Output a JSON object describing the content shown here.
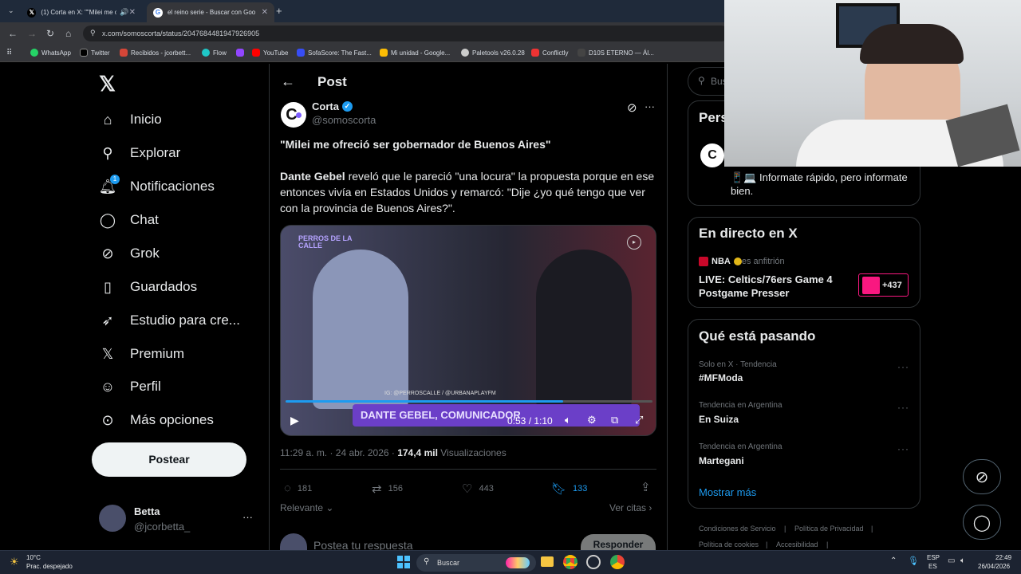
{
  "browser": {
    "tabs": [
      {
        "title": "(1) Corta en X: \"\"Milei me o"
      },
      {
        "title": "el reino serie - Buscar con Goo"
      }
    ],
    "url": "x.com/somoscorta/status/2047684481947926905",
    "bookmarks": [
      "WhatsApp",
      "Twitter",
      "Recibidos - jcorbett...",
      "Flow",
      "",
      "YouTube",
      "SofaScore: The Fast...",
      "Mi unidad - Google...",
      "Paletools v26.0.28",
      "Conflictly",
      "D10S ETERNO — Ál..."
    ]
  },
  "sidebar": {
    "items": [
      {
        "label": "Inicio",
        "icon": "home-icon"
      },
      {
        "label": "Explorar",
        "icon": "search-icon"
      },
      {
        "label": "Notificaciones",
        "icon": "bell-icon",
        "badge": "1"
      },
      {
        "label": "Chat",
        "icon": "chat-icon"
      },
      {
        "label": "Grok",
        "icon": "grok-icon"
      },
      {
        "label": "Guardados",
        "icon": "bookmark-icon"
      },
      {
        "label": "Estudio para cre...",
        "icon": "rocket-icon"
      },
      {
        "label": "Premium",
        "icon": "x-logo-icon"
      },
      {
        "label": "Perfil",
        "icon": "person-icon"
      },
      {
        "label": "Más opciones",
        "icon": "more-icon"
      }
    ],
    "post_button": "Postear",
    "user": {
      "name": "Betta",
      "handle": "@jcorbetta_"
    }
  },
  "post": {
    "header_title": "Post",
    "author": {
      "name": "Corta",
      "handle": "@somoscorta"
    },
    "headline": "\"Milei me ofreció ser gobernador de Buenos Aires\"",
    "body_bold": "Dante Gebel",
    "body_rest": " reveló que le pareció \"una locura\" la propuesta porque en ese entonces vivía en Estados Unidos y remarcó: \"Dije ¿yo qué tengo que ver con la provincia de Buenos Aires?\".",
    "video": {
      "overlay_brand": "PERROS DE LA CALLE",
      "lower_third": "DANTE GEBEL, COMUNICADOR",
      "handles": "IG: @PERROSCALLE / @URBANAPLAYFM",
      "time": "0:53 / 1:10",
      "progress": 0.757
    },
    "meta": {
      "time": "11:29 a. m. · 24 abr. 2026 · ",
      "views": "174,4 mil",
      "views_label": " Visualizaciones"
    },
    "actions": {
      "replies": "181",
      "reposts": "156",
      "likes": "443",
      "bookmarks": "133"
    },
    "relevance": "Relevante",
    "quotes": "Ver citas",
    "reply_placeholder": "Postea tu respuesta",
    "reply_button": "Responder"
  },
  "right": {
    "search_placeholder": "Bus",
    "promo_title": "Pers",
    "promo_text": "📱💻 Informate rápido, pero informate bien.",
    "live": {
      "title": "En directo en X",
      "host": "NBA",
      "host_suffix": " es anfitrión",
      "event": "LIVE: Celtics/76ers Game 4 Postgame Presser",
      "count": "+437"
    },
    "trends_title": "Qué está pasando",
    "trends": [
      {
        "meta": "Solo en X · Tendencia",
        "name": "#MFModa"
      },
      {
        "meta": "Tendencia en Argentina",
        "name": "En Suiza"
      },
      {
        "meta": "Tendencia en Argentina",
        "name": "Martegani"
      }
    ],
    "show_more": "Mostrar más",
    "footer": [
      "Condiciones de Servicio",
      "Política de Privacidad",
      "Política de cookies",
      "Accesibilidad"
    ]
  },
  "taskbar": {
    "weather_temp": "10°C",
    "weather_desc": "Prac. despejado",
    "search": "Buscar",
    "lang_top": "ESP",
    "lang_bottom": "ES",
    "time": "22:49",
    "date": "26/04/2026"
  },
  "colors": {
    "accent": "#1d9bf0",
    "bg": "#000000",
    "border": "#2f3336",
    "muted": "#71767b"
  }
}
